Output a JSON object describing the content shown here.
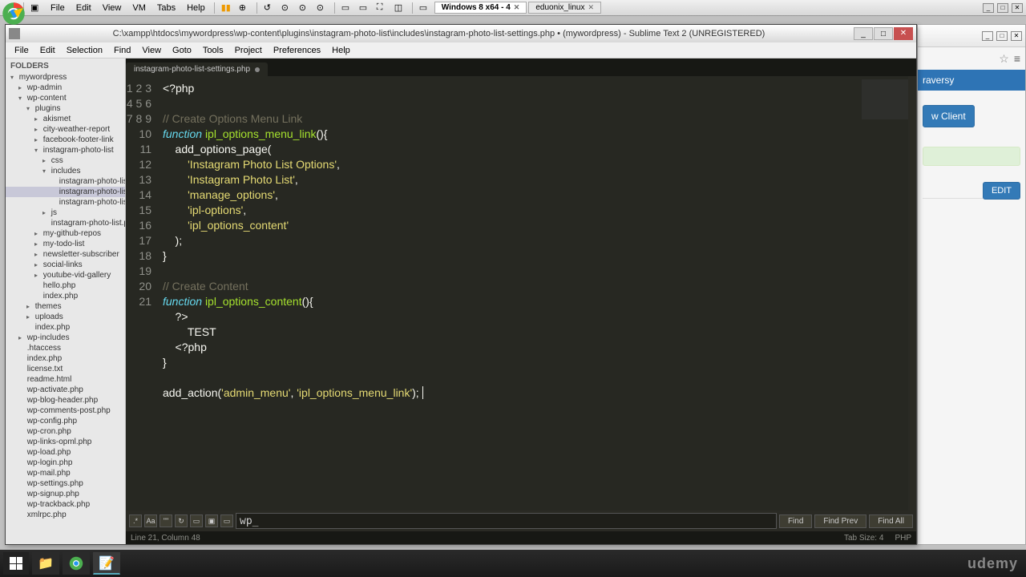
{
  "vm": {
    "menus": [
      "File",
      "Edit",
      "View",
      "VM",
      "Tabs",
      "Help"
    ],
    "tabs": [
      {
        "label": "Windows 8 x64 - 4",
        "active": true
      },
      {
        "label": "eduonix_linux",
        "active": false
      }
    ]
  },
  "browser": {
    "header": "raversy",
    "new_client": "w Client",
    "edit": "EDIT"
  },
  "sublime": {
    "title": "C:\\xampp\\htdocs\\mywordpress\\wp-content\\plugins\\instagram-photo-list\\includes\\instagram-photo-list-settings.php • (mywordpress) - Sublime Text 2 (UNREGISTERED)",
    "menus": [
      "File",
      "Edit",
      "Selection",
      "Find",
      "View",
      "Goto",
      "Tools",
      "Project",
      "Preferences",
      "Help"
    ],
    "sidebar_header": "FOLDERS",
    "tree": [
      {
        "indent": 0,
        "arrow": "▾",
        "label": "mywordpress"
      },
      {
        "indent": 1,
        "arrow": "▸",
        "label": "wp-admin"
      },
      {
        "indent": 1,
        "arrow": "▾",
        "label": "wp-content"
      },
      {
        "indent": 2,
        "arrow": "▾",
        "label": "plugins"
      },
      {
        "indent": 3,
        "arrow": "▸",
        "label": "akismet"
      },
      {
        "indent": 3,
        "arrow": "▸",
        "label": "city-weather-report"
      },
      {
        "indent": 3,
        "arrow": "▸",
        "label": "facebook-footer-link"
      },
      {
        "indent": 3,
        "arrow": "▾",
        "label": "instagram-photo-list"
      },
      {
        "indent": 4,
        "arrow": "▸",
        "label": "css"
      },
      {
        "indent": 4,
        "arrow": "▾",
        "label": "includes"
      },
      {
        "indent": 5,
        "arrow": "",
        "label": "instagram-photo-list-scri"
      },
      {
        "indent": 5,
        "arrow": "",
        "label": "instagram-photo-list-sett",
        "sel": true
      },
      {
        "indent": 5,
        "arrow": "",
        "label": "instagram-photo-list-sho"
      },
      {
        "indent": 4,
        "arrow": "▸",
        "label": "js"
      },
      {
        "indent": 4,
        "arrow": "",
        "label": "instagram-photo-list.php"
      },
      {
        "indent": 3,
        "arrow": "▸",
        "label": "my-github-repos"
      },
      {
        "indent": 3,
        "arrow": "▸",
        "label": "my-todo-list"
      },
      {
        "indent": 3,
        "arrow": "▸",
        "label": "newsletter-subscriber"
      },
      {
        "indent": 3,
        "arrow": "▸",
        "label": "social-links"
      },
      {
        "indent": 3,
        "arrow": "▸",
        "label": "youtube-vid-gallery"
      },
      {
        "indent": 3,
        "arrow": "",
        "label": "hello.php"
      },
      {
        "indent": 3,
        "arrow": "",
        "label": "index.php"
      },
      {
        "indent": 2,
        "arrow": "▸",
        "label": "themes"
      },
      {
        "indent": 2,
        "arrow": "▸",
        "label": "uploads"
      },
      {
        "indent": 2,
        "arrow": "",
        "label": "index.php"
      },
      {
        "indent": 1,
        "arrow": "▸",
        "label": "wp-includes"
      },
      {
        "indent": 1,
        "arrow": "",
        "label": ".htaccess"
      },
      {
        "indent": 1,
        "arrow": "",
        "label": "index.php"
      },
      {
        "indent": 1,
        "arrow": "",
        "label": "license.txt"
      },
      {
        "indent": 1,
        "arrow": "",
        "label": "readme.html"
      },
      {
        "indent": 1,
        "arrow": "",
        "label": "wp-activate.php"
      },
      {
        "indent": 1,
        "arrow": "",
        "label": "wp-blog-header.php"
      },
      {
        "indent": 1,
        "arrow": "",
        "label": "wp-comments-post.php"
      },
      {
        "indent": 1,
        "arrow": "",
        "label": "wp-config.php"
      },
      {
        "indent": 1,
        "arrow": "",
        "label": "wp-cron.php"
      },
      {
        "indent": 1,
        "arrow": "",
        "label": "wp-links-opml.php"
      },
      {
        "indent": 1,
        "arrow": "",
        "label": "wp-load.php"
      },
      {
        "indent": 1,
        "arrow": "",
        "label": "wp-login.php"
      },
      {
        "indent": 1,
        "arrow": "",
        "label": "wp-mail.php"
      },
      {
        "indent": 1,
        "arrow": "",
        "label": "wp-settings.php"
      },
      {
        "indent": 1,
        "arrow": "",
        "label": "wp-signup.php"
      },
      {
        "indent": 1,
        "arrow": "",
        "label": "wp-trackback.php"
      },
      {
        "indent": 1,
        "arrow": "",
        "label": "xmlrpc.php"
      }
    ],
    "tab_name": "instagram-photo-list-settings.php",
    "lines": [
      1,
      2,
      3,
      4,
      5,
      6,
      7,
      8,
      9,
      10,
      11,
      12,
      13,
      14,
      15,
      16,
      17,
      18,
      19,
      20,
      21
    ],
    "find_value": "wp_",
    "find_btns": [
      "Find",
      "Find Prev",
      "Find All"
    ],
    "status_left": "Line 21, Column 48",
    "status_tab": "Tab Size: 4",
    "status_lang": "PHP"
  },
  "watermark": "udemy"
}
